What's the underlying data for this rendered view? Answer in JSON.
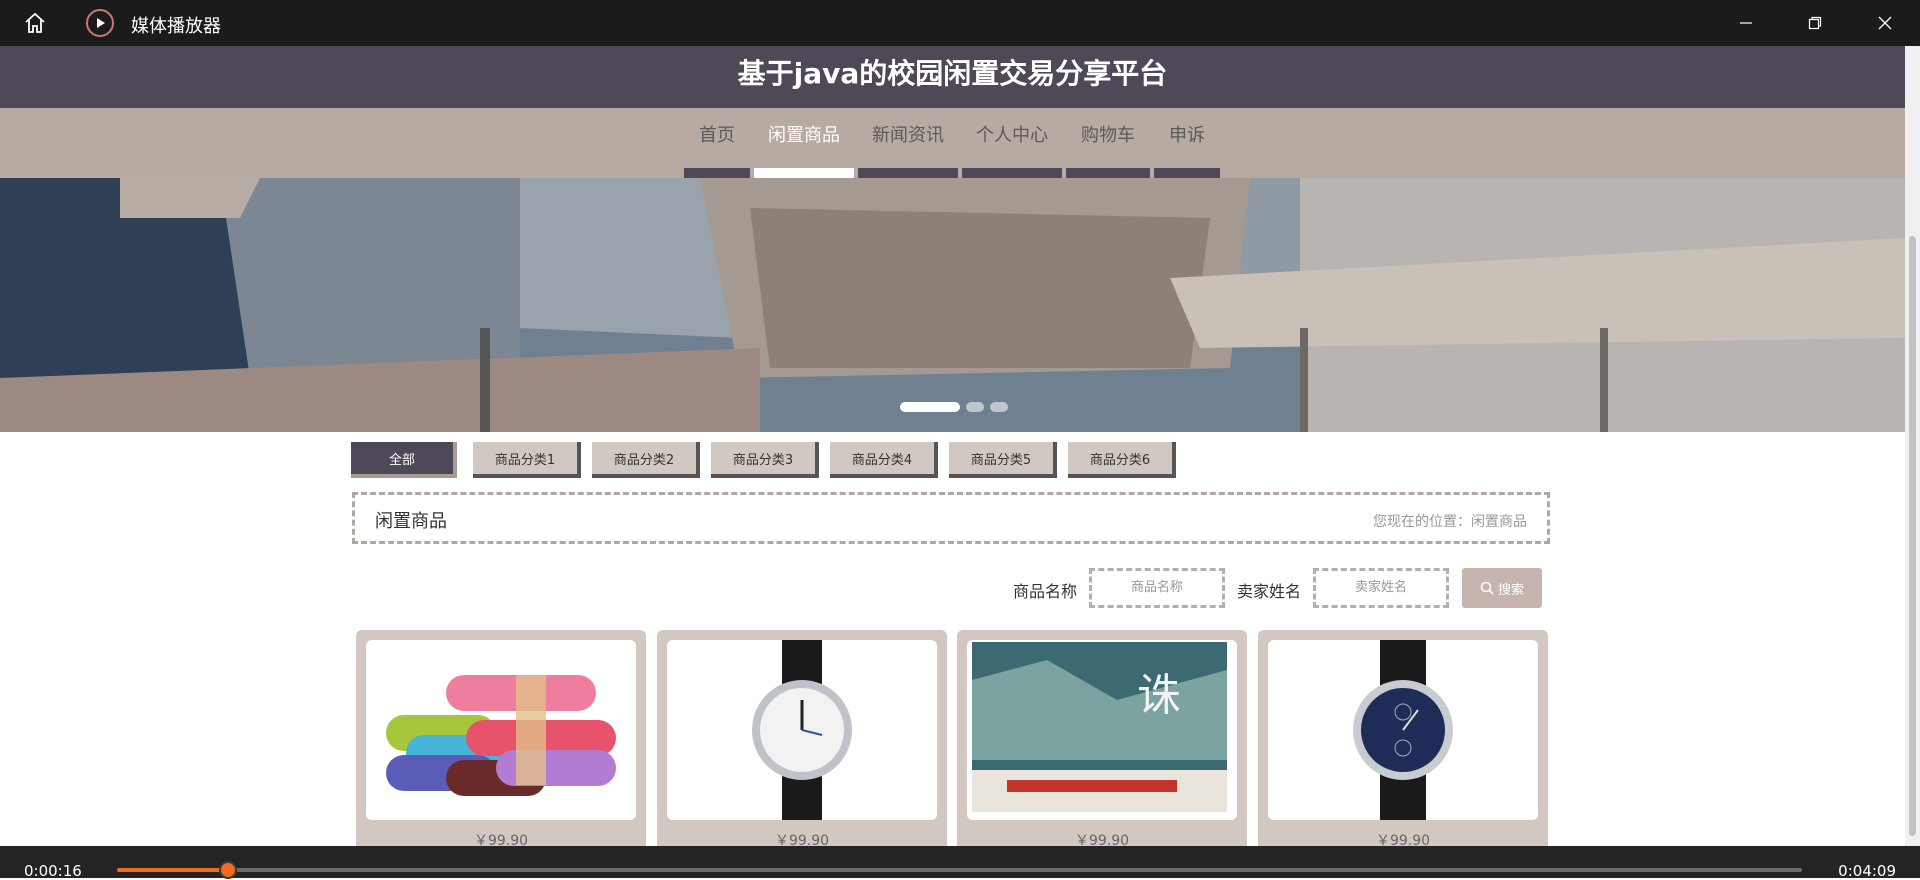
{
  "window": {
    "app_title": "媒体播放器"
  },
  "site": {
    "title": "基于java的校园闲置交易分享平台",
    "nav": [
      "首页",
      "闲置商品",
      "新闻资讯",
      "个人中心",
      "购物车",
      "申诉"
    ],
    "active_nav": "闲置商品"
  },
  "categories": [
    "全部",
    "商品分类1",
    "商品分类2",
    "商品分类3",
    "商品分类4",
    "商品分类5",
    "商品分类6"
  ],
  "breadcrumb": {
    "title": "闲置商品",
    "location": "您现在的位置：闲置商品"
  },
  "search": {
    "name_label": "商品名称",
    "name_placeholder": "商品名称",
    "seller_label": "卖家姓名",
    "seller_placeholder": "卖家姓名",
    "button": "搜索"
  },
  "products": [
    {
      "image": "yoga-mats",
      "price": "￥99.90"
    },
    {
      "image": "watch-silver",
      "price": "￥99.90"
    },
    {
      "image": "book-zhuxian",
      "price": "￥99.90"
    },
    {
      "image": "watch-blue",
      "price": "￥99.90"
    }
  ],
  "player": {
    "current": "0:00:16",
    "total": "0:04:09",
    "progress": 0.066
  },
  "colors": {
    "header": "#4e4857",
    "nav": "#b7aaa3",
    "accent": "#f26b1d",
    "card": "#d2c8c1"
  }
}
